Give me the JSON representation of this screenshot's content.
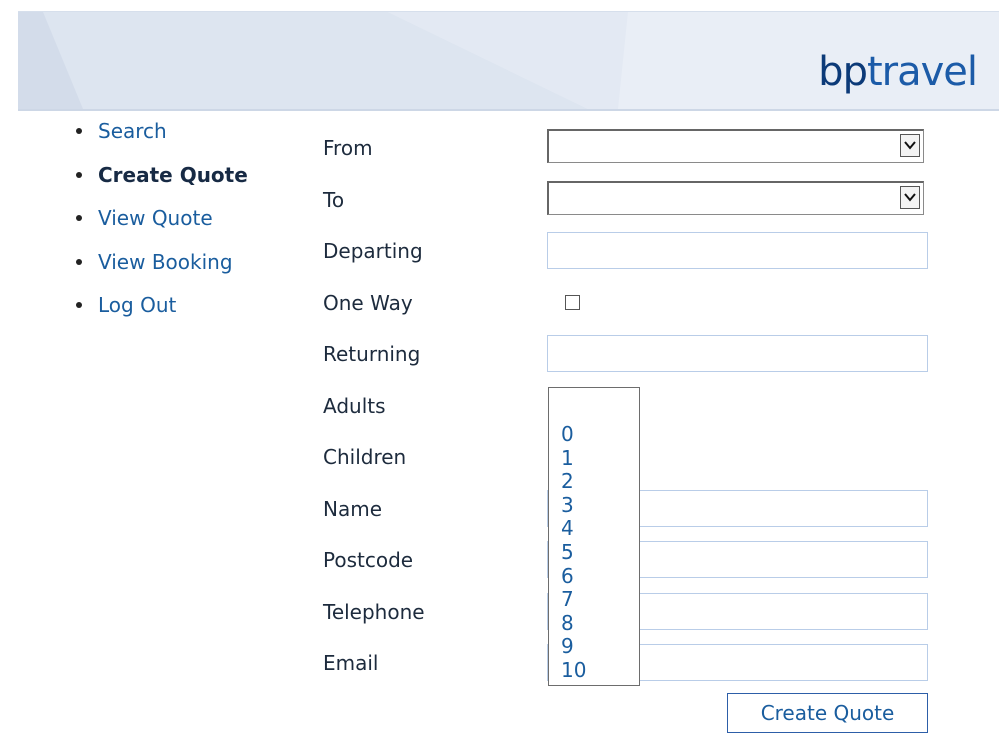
{
  "header": {
    "logo_bp": "bp",
    "logo_travel": "travel"
  },
  "nav": {
    "items": [
      {
        "label": "Search"
      },
      {
        "label": "Create Quote",
        "active": true
      },
      {
        "label": "View Quote"
      },
      {
        "label": "View Booking"
      },
      {
        "label": "Log Out"
      }
    ]
  },
  "form": {
    "from_label": "From",
    "to_label": "To",
    "departing_label": "Departing",
    "one_way_label": "One Way",
    "returning_label": "Returning",
    "adults_label": "Adults",
    "children_label": "Children",
    "name_label": "Name",
    "postcode_label": "Postcode",
    "telephone_label": "Telephone",
    "email_label": "Email",
    "from_value": "",
    "to_value": "",
    "one_way_checked": false,
    "adults_options": [
      "0",
      "1",
      "2",
      "3",
      "4",
      "5",
      "6",
      "7",
      "8",
      "9",
      "10"
    ],
    "submit_label": "Create Quote"
  },
  "colors": {
    "link": "#1a5d9e",
    "logo_dark": "#0c3a78",
    "logo_light": "#1c5ba8",
    "input_border": "#b9cde8"
  }
}
